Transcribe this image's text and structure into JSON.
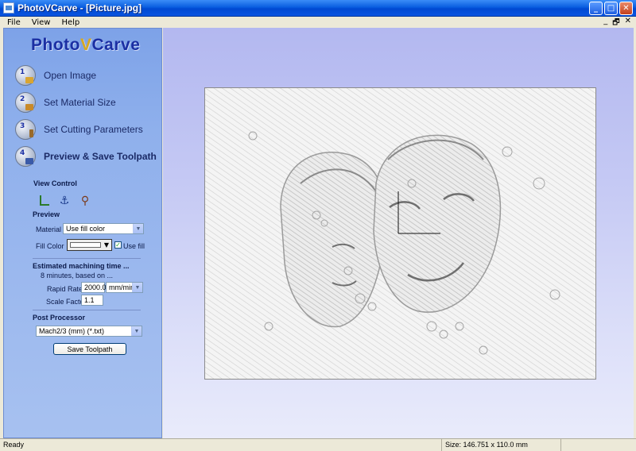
{
  "window": {
    "title": "PhotoVCarve - [Picture.jpg]",
    "minimize": "_",
    "maximize": "□",
    "close": "✕"
  },
  "menu": {
    "items": [
      "File",
      "View",
      "Help"
    ],
    "mdi_minimize": "_",
    "mdi_restore": "🗗",
    "mdi_close": "✕"
  },
  "sidebar": {
    "brand_prefix": "Photo",
    "brand_v": "V",
    "brand_suffix": "Carve",
    "steps": [
      {
        "num": "1",
        "label": "Open Image",
        "icon": "folder-icon"
      },
      {
        "num": "2",
        "label": "Set Material Size",
        "icon": "material-icon"
      },
      {
        "num": "3",
        "label": "Set Cutting Parameters",
        "icon": "cutter-icon"
      },
      {
        "num": "4",
        "label": "Preview & Save Toolpath",
        "icon": "disk-icon"
      }
    ],
    "view_control": {
      "title": "View Control",
      "icons": [
        "axes-icon",
        "anchor-icon",
        "zoom-icon"
      ]
    },
    "preview": {
      "title": "Preview",
      "material_label": "Material",
      "material_value": "Use fill color",
      "fill_color_label": "Fill Color",
      "fill_color_value": "#ffffff",
      "use_fill_label": "Use fill",
      "use_fill_checked": true
    },
    "machining": {
      "title": "Estimated machining time ...",
      "summary": "8 minutes, based on ...",
      "rapid_rate_label": "Rapid Rate",
      "rapid_rate_value": "2000.0",
      "rapid_rate_unit": "mm/min",
      "scale_factor_label": "Scale Factor",
      "scale_factor_value": "1.1"
    },
    "post_processor": {
      "title": "Post Processor",
      "value": "Mach2/3 (mm) (*.txt)",
      "save_button": "Save Toolpath"
    }
  },
  "statusbar": {
    "left": "Ready",
    "size": "Size: 146.751 x 110.0 mm"
  },
  "colors": {
    "accent": "#1b2fa3",
    "brand_v": "#d8a820",
    "titlebar": "#0a5ee0"
  }
}
